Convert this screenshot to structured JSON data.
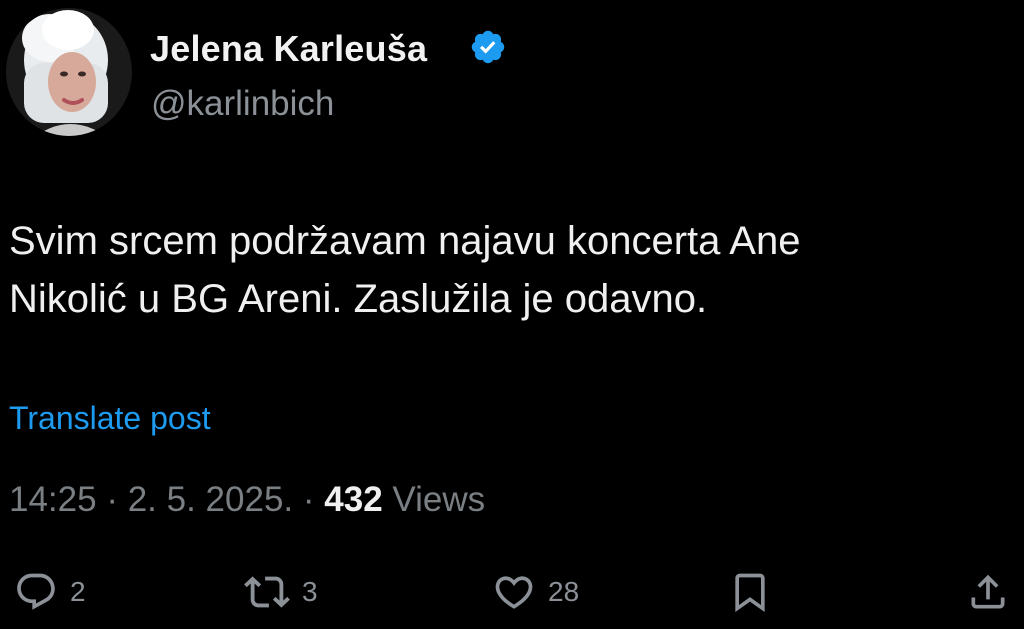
{
  "author": {
    "display_name": "Jelena Karleuša",
    "handle": "@karlinbich",
    "verified": true
  },
  "post": {
    "text_lines": [
      "Svim srcem podržavam najavu koncerta Ane",
      "Nikolić u BG Areni. Zaslužila je odavno."
    ],
    "translate_label": "Translate post",
    "time": "14:25",
    "date": "2. 5. 2025.",
    "separator": "·",
    "views_count": "432",
    "views_label": "Views"
  },
  "actions": {
    "replies": "2",
    "reposts": "3",
    "likes": "28"
  },
  "colors": {
    "background": "#000000",
    "link": "#1d9bf0",
    "verified": "#1d9bf0",
    "muted": "#8b9197"
  },
  "icons": [
    "verified-badge-icon",
    "reply-icon",
    "repost-icon",
    "like-icon",
    "bookmark-icon",
    "share-icon"
  ]
}
